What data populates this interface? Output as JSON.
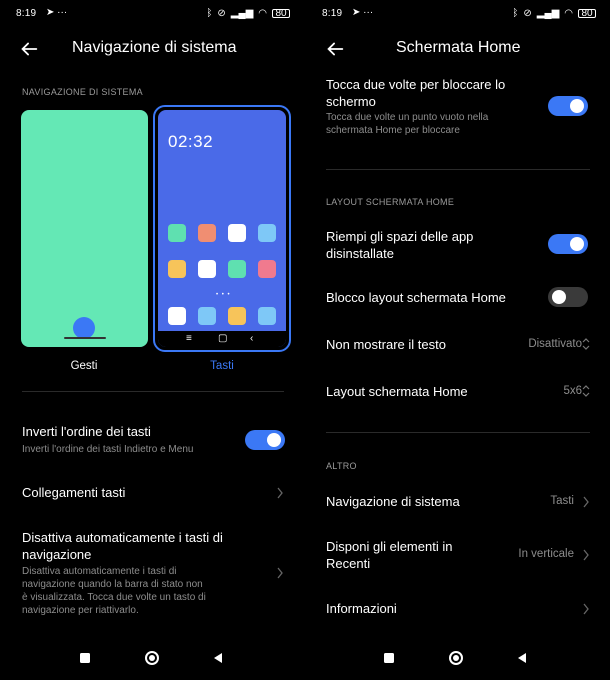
{
  "left": {
    "status": {
      "time": "8:19",
      "battery": "80"
    },
    "title": "Navigazione di sistema",
    "section_label": "NAVIGAZIONE DI SISTEMA",
    "preview": {
      "phone_time": "02:32",
      "options": [
        {
          "label": "Gesti",
          "selected": false
        },
        {
          "label": "Tasti",
          "selected": true
        }
      ]
    },
    "rows": [
      {
        "title": "Inverti l'ordine dei tasti",
        "subtitle": "Inverti l'ordine dei tasti Indietro e Menu",
        "toggle": true
      },
      {
        "title": "Collegamenti tasti"
      },
      {
        "title_line1": "Disattiva automaticamente i tasti di",
        "title_line2": "navigazione",
        "subtitle_lines": [
          "Disattiva automaticamente i tasti di",
          "navigazione quando la barra di stato non",
          "è visualizzata. Tocca due volte un tasto di",
          "navigazione per riattivarlo."
        ]
      }
    ]
  },
  "right": {
    "status": {
      "time": "8:19",
      "battery": "80"
    },
    "title": "Schermata Home",
    "top_row": {
      "title_line1": "Tocca due volte per bloccare lo",
      "title_line2": "schermo",
      "subtitle_line1": "Tocca due volte un punto vuoto nella",
      "subtitle_line2": "schermata Home per bloccare",
      "toggle": true
    },
    "layout_section": "LAYOUT SCHERMATA HOME",
    "layout_rows": [
      {
        "title_line1": "Riempi gli spazi delle app",
        "title_line2": "disinstallate",
        "toggle": true
      },
      {
        "title": "Blocco layout schermata Home",
        "toggle": false
      },
      {
        "title": "Non mostrare il testo",
        "value": "Disattivato"
      },
      {
        "title": "Layout schermata Home",
        "value": "5x6"
      }
    ],
    "altro_section": "ALTRO",
    "altro_rows": [
      {
        "title": "Navigazione di sistema",
        "value": "Tasti"
      },
      {
        "title_line1": "Disponi gli elementi in",
        "title_line2": "Recenti",
        "value": "In verticale"
      },
      {
        "title": "Informazioni"
      }
    ]
  },
  "colors": {
    "accent": "#3b78f5",
    "gest_card": "#64e8b5",
    "tasti_card": "#4a6ae8",
    "background": "#000000",
    "subtext": "#8d8d8d"
  },
  "icons": [
    "back-arrow-icon",
    "chevron-right-icon",
    "up-down-icon",
    "bluetooth-icon",
    "wifi-icon",
    "signal-icon",
    "battery-icon",
    "telegram-icon",
    "recents-square-icon",
    "home-circle-icon",
    "back-triangle-icon"
  ]
}
